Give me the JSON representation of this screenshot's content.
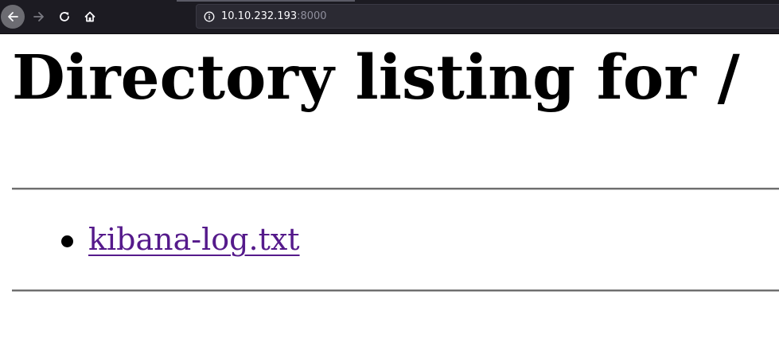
{
  "browser": {
    "nav": {
      "back_icon": "arrow-left-icon",
      "forward_icon": "arrow-right-icon",
      "reload_icon": "reload-icon",
      "home_icon": "home-icon"
    },
    "address_bar": {
      "info_icon": "info-icon",
      "host": "10.10.232.193",
      "port": ":8000"
    },
    "colors": {
      "toolbar": "#1c1b22",
      "urlbar": "#2b2a33",
      "visited_link": "#551a8b"
    }
  },
  "page": {
    "title": "Directory listing for /",
    "files": [
      {
        "name": "kibana-log.txt"
      }
    ]
  }
}
